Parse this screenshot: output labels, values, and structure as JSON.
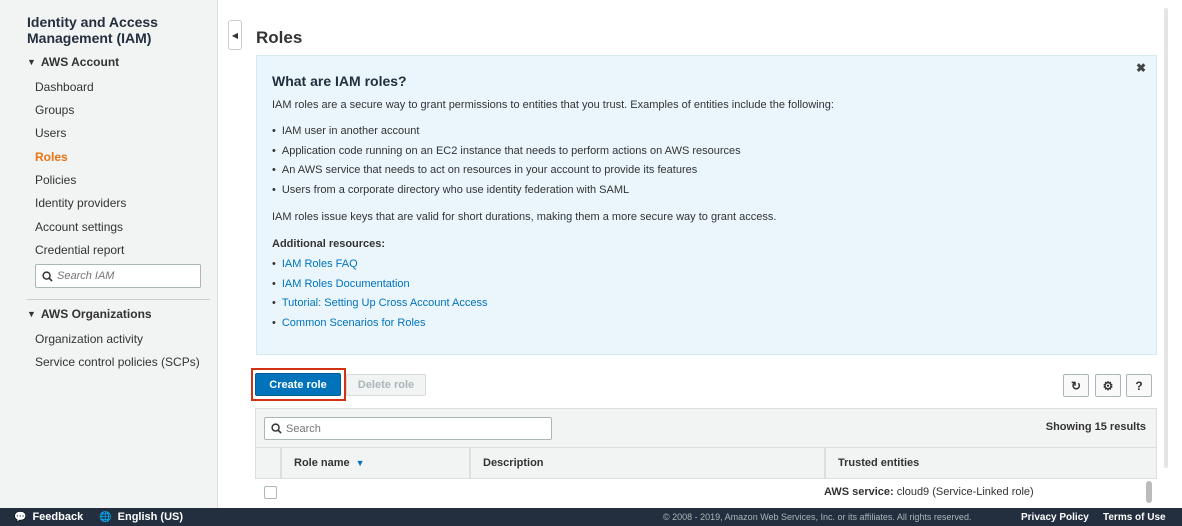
{
  "sidebar": {
    "title": "Identity and Access Management (IAM)",
    "section_account": "AWS Account",
    "items": [
      {
        "label": "Dashboard"
      },
      {
        "label": "Groups"
      },
      {
        "label": "Users"
      },
      {
        "label": "Roles"
      },
      {
        "label": "Policies"
      },
      {
        "label": "Identity providers"
      },
      {
        "label": "Account settings"
      },
      {
        "label": "Credential report"
      }
    ],
    "search_placeholder": "Search IAM",
    "section_org": "AWS Organizations",
    "org_items": [
      {
        "label": "Organization activity"
      },
      {
        "label": "Service control policies (SCPs)"
      }
    ],
    "active_item": "Roles"
  },
  "main": {
    "page_title": "Roles"
  },
  "info": {
    "heading": "What are IAM roles?",
    "intro": "IAM roles are a secure way to grant permissions to entities that you trust. Examples of entities include the following:",
    "entities": [
      "IAM user in another account",
      "Application code running on an EC2 instance that needs to perform actions on AWS resources",
      "An AWS service that needs to act on resources in your account to provide its features",
      "Users from a corporate directory who use identity federation with SAML"
    ],
    "summary": "IAM roles issue keys that are valid for short durations, making them a more secure way to grant access.",
    "resources_heading": "Additional resources:",
    "resources": [
      "IAM Roles FAQ",
      "IAM Roles Documentation",
      "Tutorial: Setting Up Cross Account Access",
      "Common Scenarios for Roles"
    ],
    "close_glyph": "✖"
  },
  "toolbar": {
    "create_label": "Create role",
    "delete_label": "Delete role"
  },
  "table": {
    "search_placeholder": "Search",
    "results_text": "Showing 15 results",
    "columns": [
      "Role name",
      "Description",
      "Trusted entities"
    ],
    "rows": [
      {
        "role_name": "",
        "description": "",
        "trusted_bold": "AWS service:",
        "trusted_rest": " cloud9 (Service-Linked role)"
      }
    ]
  },
  "footer": {
    "feedback": "Feedback",
    "language": "English (US)",
    "copyright": "© 2008 - 2019, Amazon Web Services, Inc. or its affiliates. All rights reserved.",
    "privacy": "Privacy Policy",
    "terms": "Terms of Use"
  },
  "colors": {
    "accent_orange": "#ec7211",
    "primary_blue": "#0073bb",
    "highlight_red": "#d13212",
    "footer_bg": "#232f3e"
  }
}
